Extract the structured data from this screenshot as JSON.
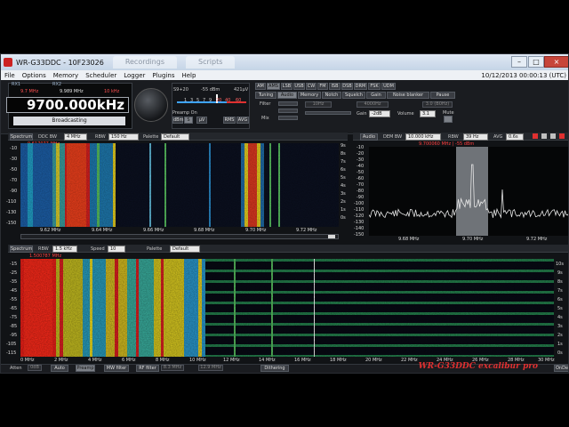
{
  "window": {
    "title": "WR-G33DDC - 10F23026",
    "ghost_tabs": [
      "Recordings",
      "Scripts"
    ],
    "controls": {
      "minimize": "–",
      "maximize": "□",
      "close": "×"
    }
  },
  "menu": {
    "items": [
      "File",
      "Options",
      "Memory",
      "Scheduler",
      "Logger",
      "Plugins",
      "Help"
    ],
    "clock": "10/12/2013 00:00:13 (UTC)"
  },
  "display": {
    "rx1_label": "RX1",
    "rx2_label": "RX2",
    "rx1_freq": "9.7 MHz",
    "rx2_freq": "9.989 MHz",
    "rx2_extra": "10 kHz",
    "main_frequency": "9700.000kHz",
    "mode_label": "Broadcasting"
  },
  "smeter": {
    "reading": "S9+20",
    "dbm": "-55 dBm",
    "uv": "421µV",
    "scale": [
      "1",
      "3",
      "5",
      "7",
      "9",
      "20",
      "40",
      "60"
    ],
    "preamp": "Preamp On",
    "unit_buttons": [
      "dBm",
      "S",
      "µV"
    ],
    "btns": [
      "RMS",
      "AVG"
    ]
  },
  "modes": [
    "AM",
    "AMS",
    "LSB",
    "USB",
    "CW",
    "FM",
    "ISB",
    "DSB",
    "DRM",
    "FSK",
    "UDM"
  ],
  "active_mode": "AMS",
  "function_tabs": [
    "Tuning",
    "Audio",
    "Memory",
    "Notch",
    "Squelch",
    "Gain",
    "Noise blanker",
    "Pause"
  ],
  "active_tab": "Audio",
  "audio_controls": {
    "filter": "Filter",
    "mix": "Mix",
    "in1": "10Hz",
    "in2": "4000Hz",
    "in3": "3.0 (B0Hz)",
    "gain_label": "Gain",
    "gain_value": "-2dB",
    "volume_label": "Volume",
    "volume_value": "3.1",
    "mute": "Mute"
  },
  "ddc_panel": {
    "spectrum_btn": "Spectrum",
    "ddc_bw_label": "DDC BW",
    "ddc_bw": "4 MHz",
    "rbw_label": "RBW",
    "rbw": "150 Hz",
    "palette_label": "Palette",
    "palette": "Default",
    "marker": "9.617077 MHz",
    "y_ticks": [
      "-10",
      "-30",
      "-50",
      "-70",
      "-90",
      "-110",
      "-130",
      "-150"
    ],
    "x_ticks": [
      "9.62 MHz",
      "9.64 MHz",
      "9.66 MHz",
      "9.68 MHz",
      "9.70 MHz",
      "9.72 MHz"
    ],
    "time_ticks": [
      "9s",
      "8s",
      "7s",
      "6s",
      "5s",
      "4s",
      "3s",
      "2s",
      "1s",
      "0s"
    ]
  },
  "audio_panel": {
    "audio_btn": "Audio",
    "demod_bw_label": "DEM BW",
    "demod_bw": "10.000 kHz",
    "rbw_label": "RBW",
    "rbw": "39 Hz",
    "avg_label": "AVG",
    "avg": "0.6s",
    "marker": "9.700060 MHz | -55 dBm",
    "y_ticks": [
      "-10",
      "-20",
      "-30",
      "-40",
      "-50",
      "-60",
      "-70",
      "-80",
      "-90",
      "-100",
      "-110",
      "-120",
      "-130",
      "-140",
      "-150"
    ],
    "x_ticks": [
      "9.68 MHz",
      "9.70 MHz",
      "9.72 MHz"
    ]
  },
  "wide_panel": {
    "spectrum_btn": "Spectrum",
    "rbw_label": "RBW",
    "rbw": "1.5 kHz",
    "speed_label": "Speed",
    "speed": "10",
    "palette_label": "Palette",
    "palette": "Default",
    "marker": "1.500787 MHz",
    "y_ticks": [
      "-15",
      "-25",
      "-35",
      "-45",
      "-55",
      "-65",
      "-75",
      "-85",
      "-95",
      "-105",
      "-115"
    ],
    "x_ticks": [
      "0 MHz",
      "2 MHz",
      "4 MHz",
      "6 MHz",
      "8 MHz",
      "10 MHz",
      "12 MHz",
      "14 MHz",
      "16 MHz",
      "18 MHz",
      "20 MHz",
      "22 MHz",
      "24 MHz",
      "26 MHz",
      "28 MHz",
      "30 MHz"
    ],
    "time_ticks": [
      "10s",
      "9s",
      "8s",
      "7s",
      "6s",
      "5s",
      "4s",
      "3s",
      "2s",
      "1s",
      "0s"
    ]
  },
  "footer": {
    "atten_label": "Atten",
    "atten_value": "0dB",
    "auto": "Auto",
    "preamp": "Preamp",
    "mw_filter": "MW filter",
    "rf_filter": "RF filter",
    "rf_filter_value": "8.3 MHz",
    "rf_filter_value2": "12.9 MHz",
    "dithering": "Dithering",
    "brand": "WR-G33DDC  excalibur pro",
    "ondemand": "OnDe"
  },
  "colors": {
    "accent_red": "#e03030",
    "marker_red": "#ff4040",
    "panel_bg": "#111316",
    "trace": "#e6e6e6"
  }
}
